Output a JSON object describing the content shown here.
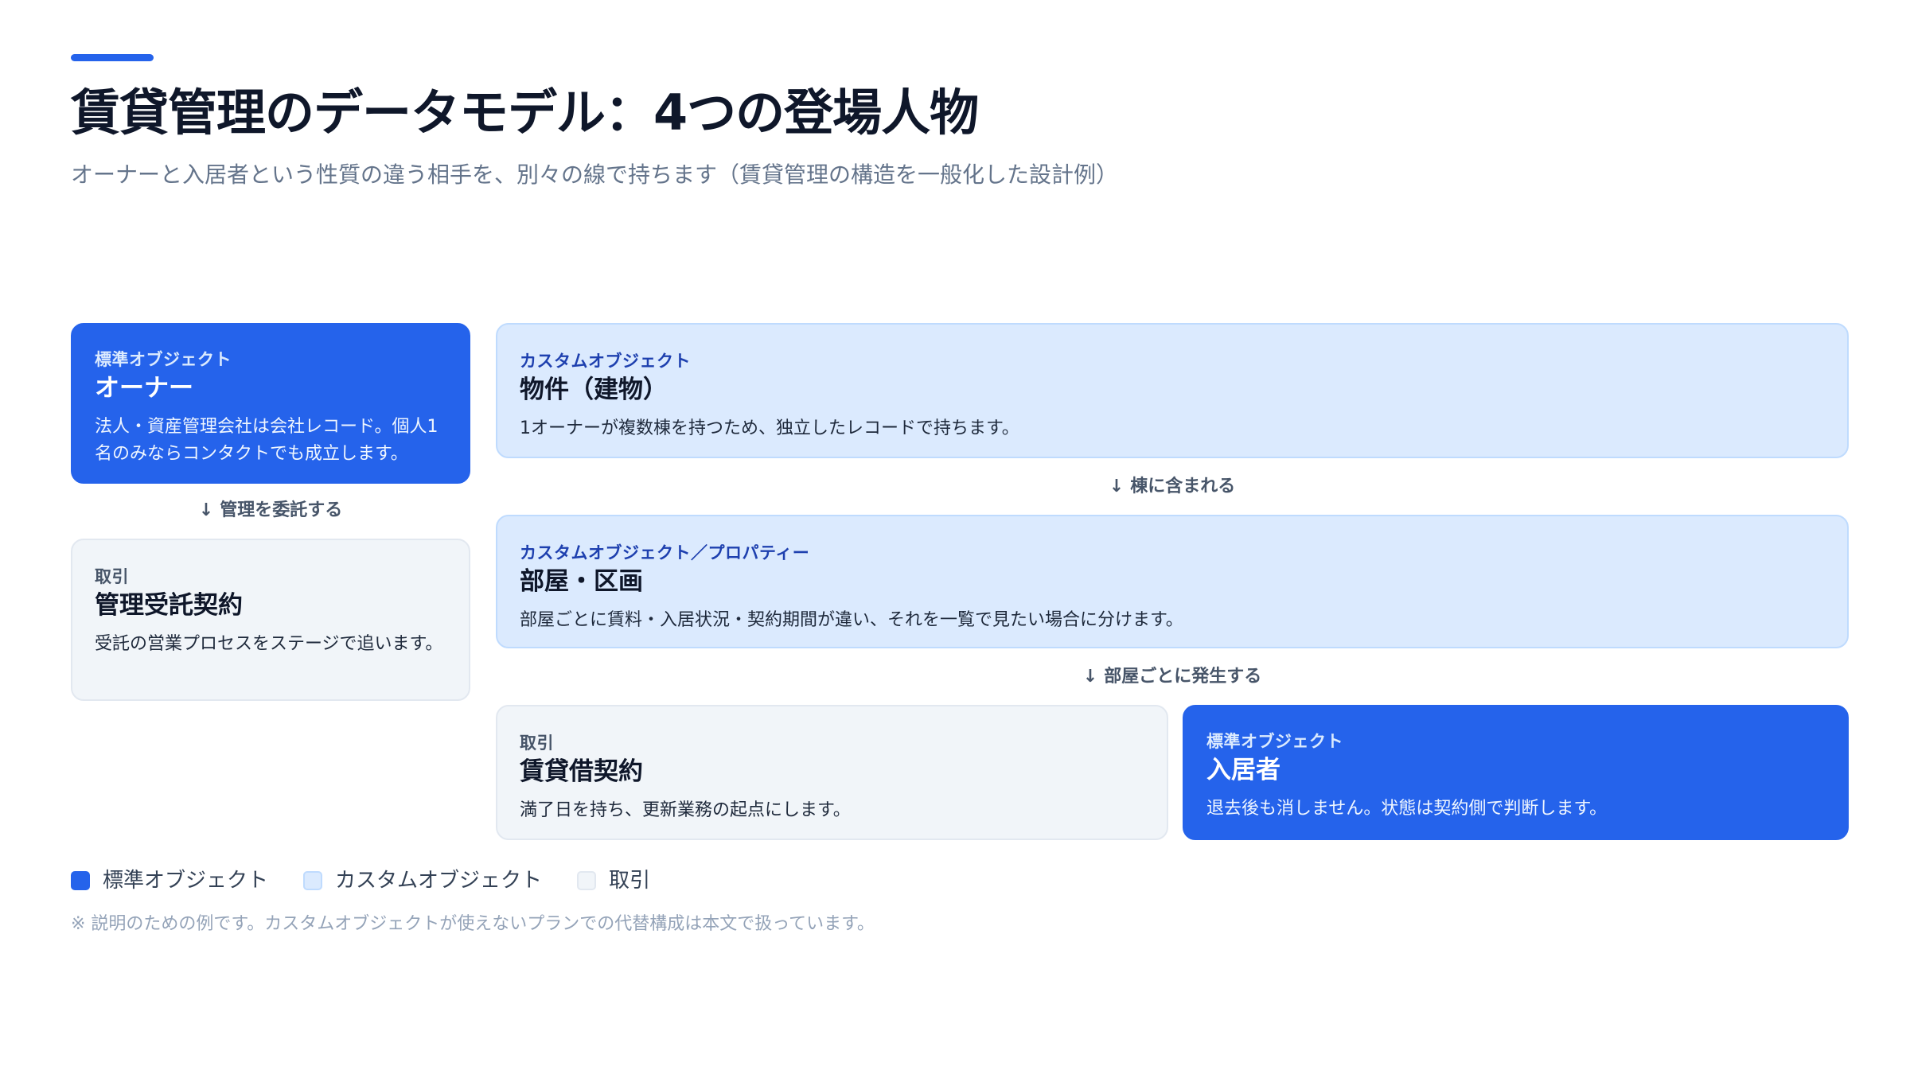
{
  "header": {
    "title": "賃貸管理のデータモデル：4つの登場人物",
    "subtitle": "オーナーと入居者という性質の違う相手を、別々の線で持ちます（賃貸管理の構造を一般化した設計例）"
  },
  "colors": {
    "accent": "#2563eb",
    "standard_fill": "#2563eb",
    "custom_fill": "#dbeafe",
    "deal_fill": "#f1f5f9"
  },
  "cards": {
    "owner": {
      "kicker": "標準オブジェクト",
      "name": "オーナー",
      "desc": "法人・資産管理会社は会社レコード。個人1名のみならコンタクトでも成立します。"
    },
    "management_contract": {
      "kicker": "取引",
      "name": "管理受託契約",
      "desc": "受託の営業プロセスをステージで追います。"
    },
    "property": {
      "kicker": "カスタムオブジェクト",
      "name": "物件（建物）",
      "desc": "1オーナーが複数棟を持つため、独立したレコードで持ちます。"
    },
    "room": {
      "kicker": "カスタムオブジェクト／プロパティー",
      "name": "部屋・区画",
      "desc": "部屋ごとに賃料・入居状況・契約期間が違い、それを一覧で見たい場合に分けます。"
    },
    "lease": {
      "kicker": "取引",
      "name": "賃貸借契約",
      "desc": "満了日を持ち、更新業務の起点にします。"
    },
    "tenant": {
      "kicker": "標準オブジェクト",
      "name": "入居者",
      "desc": "退去後も消しません。状態は契約側で判断します。"
    }
  },
  "connectors": {
    "owner_to_contract": "管理を委託する",
    "property_to_room": "棟に含まれる",
    "room_to_lease": "部屋ごとに発生する"
  },
  "legend": {
    "standard": "標準オブジェクト",
    "custom": "カスタムオブジェクト",
    "deal": "取引"
  },
  "footnote": "※ 説明のための例です。カスタムオブジェクトが使えないプランでの代替構成は本文で扱っています。"
}
